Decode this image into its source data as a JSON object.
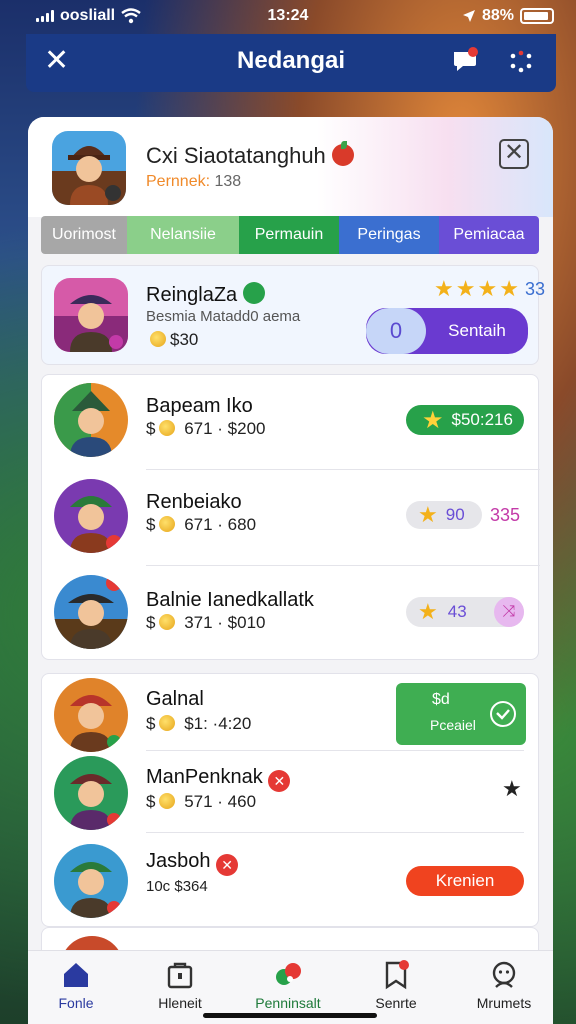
{
  "status": {
    "carrier": "oosliall",
    "time": "13:24",
    "battery": "88%"
  },
  "app": {
    "title": "Nedangai"
  },
  "profile": {
    "name": "Cxi Siaotatanghuh",
    "sub_label": "Pernnek:",
    "sub_value": "138"
  },
  "tabs": [
    {
      "label": "Uorimost",
      "color": "#a7a7a7"
    },
    {
      "label": "Nelansiie",
      "color": "#8bcf8a"
    },
    {
      "label": "Permauin",
      "color": "#27a14a"
    },
    {
      "label": "Peringas",
      "color": "#3b6fd0"
    },
    {
      "label": "Pemiacaa",
      "color": "#6a4ed6"
    }
  ],
  "featured": {
    "name": "ReinglaZa",
    "sub": "Besmia Matadd0 aema",
    "price": "$30",
    "rating": "33",
    "toggle_value": "0",
    "button": "Sentaih"
  },
  "list1": [
    {
      "name": "Bapeam Iko",
      "prefix": "$",
      "range": "671 · $200",
      "pill_text": "$50:216",
      "pill_color": "#27a14a"
    },
    {
      "name": "Renbeiako",
      "prefix": "$",
      "range": "671 · 680",
      "pill_text": "90",
      "pill_extra": "335",
      "pill_color": "#e6e6ea"
    },
    {
      "name": "Balnie Ianedkallatk",
      "prefix": "$",
      "range": "371 · $010",
      "pill_text": "43",
      "pill_color": "#e6e6ea"
    }
  ],
  "list2": [
    {
      "name": "Galnal",
      "prefix": "$",
      "range": "$1: ·4:20",
      "action_top": "$d",
      "action_bottom": "Pceaiel"
    },
    {
      "name": "ManPenknak",
      "prefix": "$",
      "range": "571 · 460",
      "action_icon": "star-icon"
    },
    {
      "name": "Jasboh",
      "prefix": "10c",
      "range": "$364",
      "action_label": "Krenien"
    }
  ],
  "nav": [
    {
      "label": "Fonle",
      "icon": "home-icon",
      "active": true
    },
    {
      "label": "Hleneit",
      "icon": "bag-icon"
    },
    {
      "label": "Penninsalt",
      "icon": "puzzle-icon"
    },
    {
      "label": "Senrte",
      "icon": "bookmark-icon"
    },
    {
      "label": "Mrumets",
      "icon": "person-icon"
    }
  ]
}
